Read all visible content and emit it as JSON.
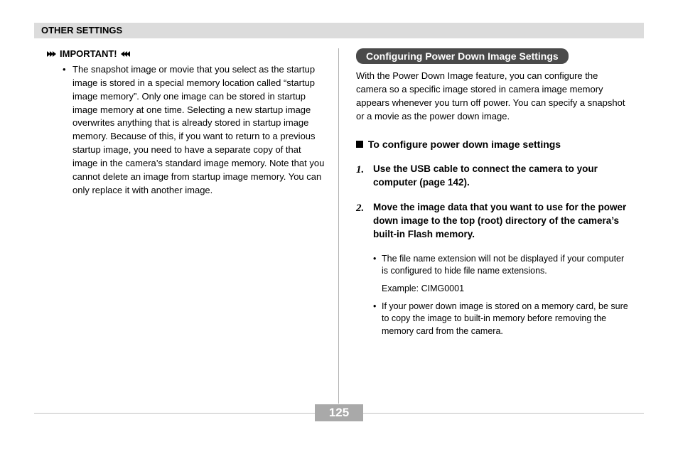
{
  "header": "OTHER SETTINGS",
  "left": {
    "important_label": "IMPORTANT!",
    "bullet": "The snapshot image or movie that you select as the startup image is stored in a special memory location called “startup image memory”. Only one image can be stored in startup image memory at one time. Selecting a new startup image overwrites anything that is already stored in startup image memory. Because of this, if you want to return to a previous startup image, you need to have a separate copy of that image in the camera’s standard image memory. Note that you cannot delete an image from startup image memory. You can only replace it with another image."
  },
  "right": {
    "section_title": "Configuring Power Down Image Settings",
    "intro": "With the Power Down Image feature, you can configure the camera so a specific image stored in camera image memory appears whenever you turn off power. You can specify a snapshot or a movie as the power down image.",
    "sub_heading": "To configure power down image settings",
    "steps": [
      {
        "num": "1.",
        "text": "Use the USB cable to connect the camera to your computer (page 142)."
      },
      {
        "num": "2.",
        "text": "Move the image data that you want to use for the power down image to the top (root) directory of the camera’s built-in Flash memory."
      }
    ],
    "sub_bullets": [
      "The file name extension will not be displayed if your computer is configured to hide file name extensions.",
      "If your power down image is stored on a memory card, be sure to copy the image to built-in memory before removing the memory card from the camera."
    ],
    "example": "Example: CIMG0001"
  },
  "page_number": "125"
}
